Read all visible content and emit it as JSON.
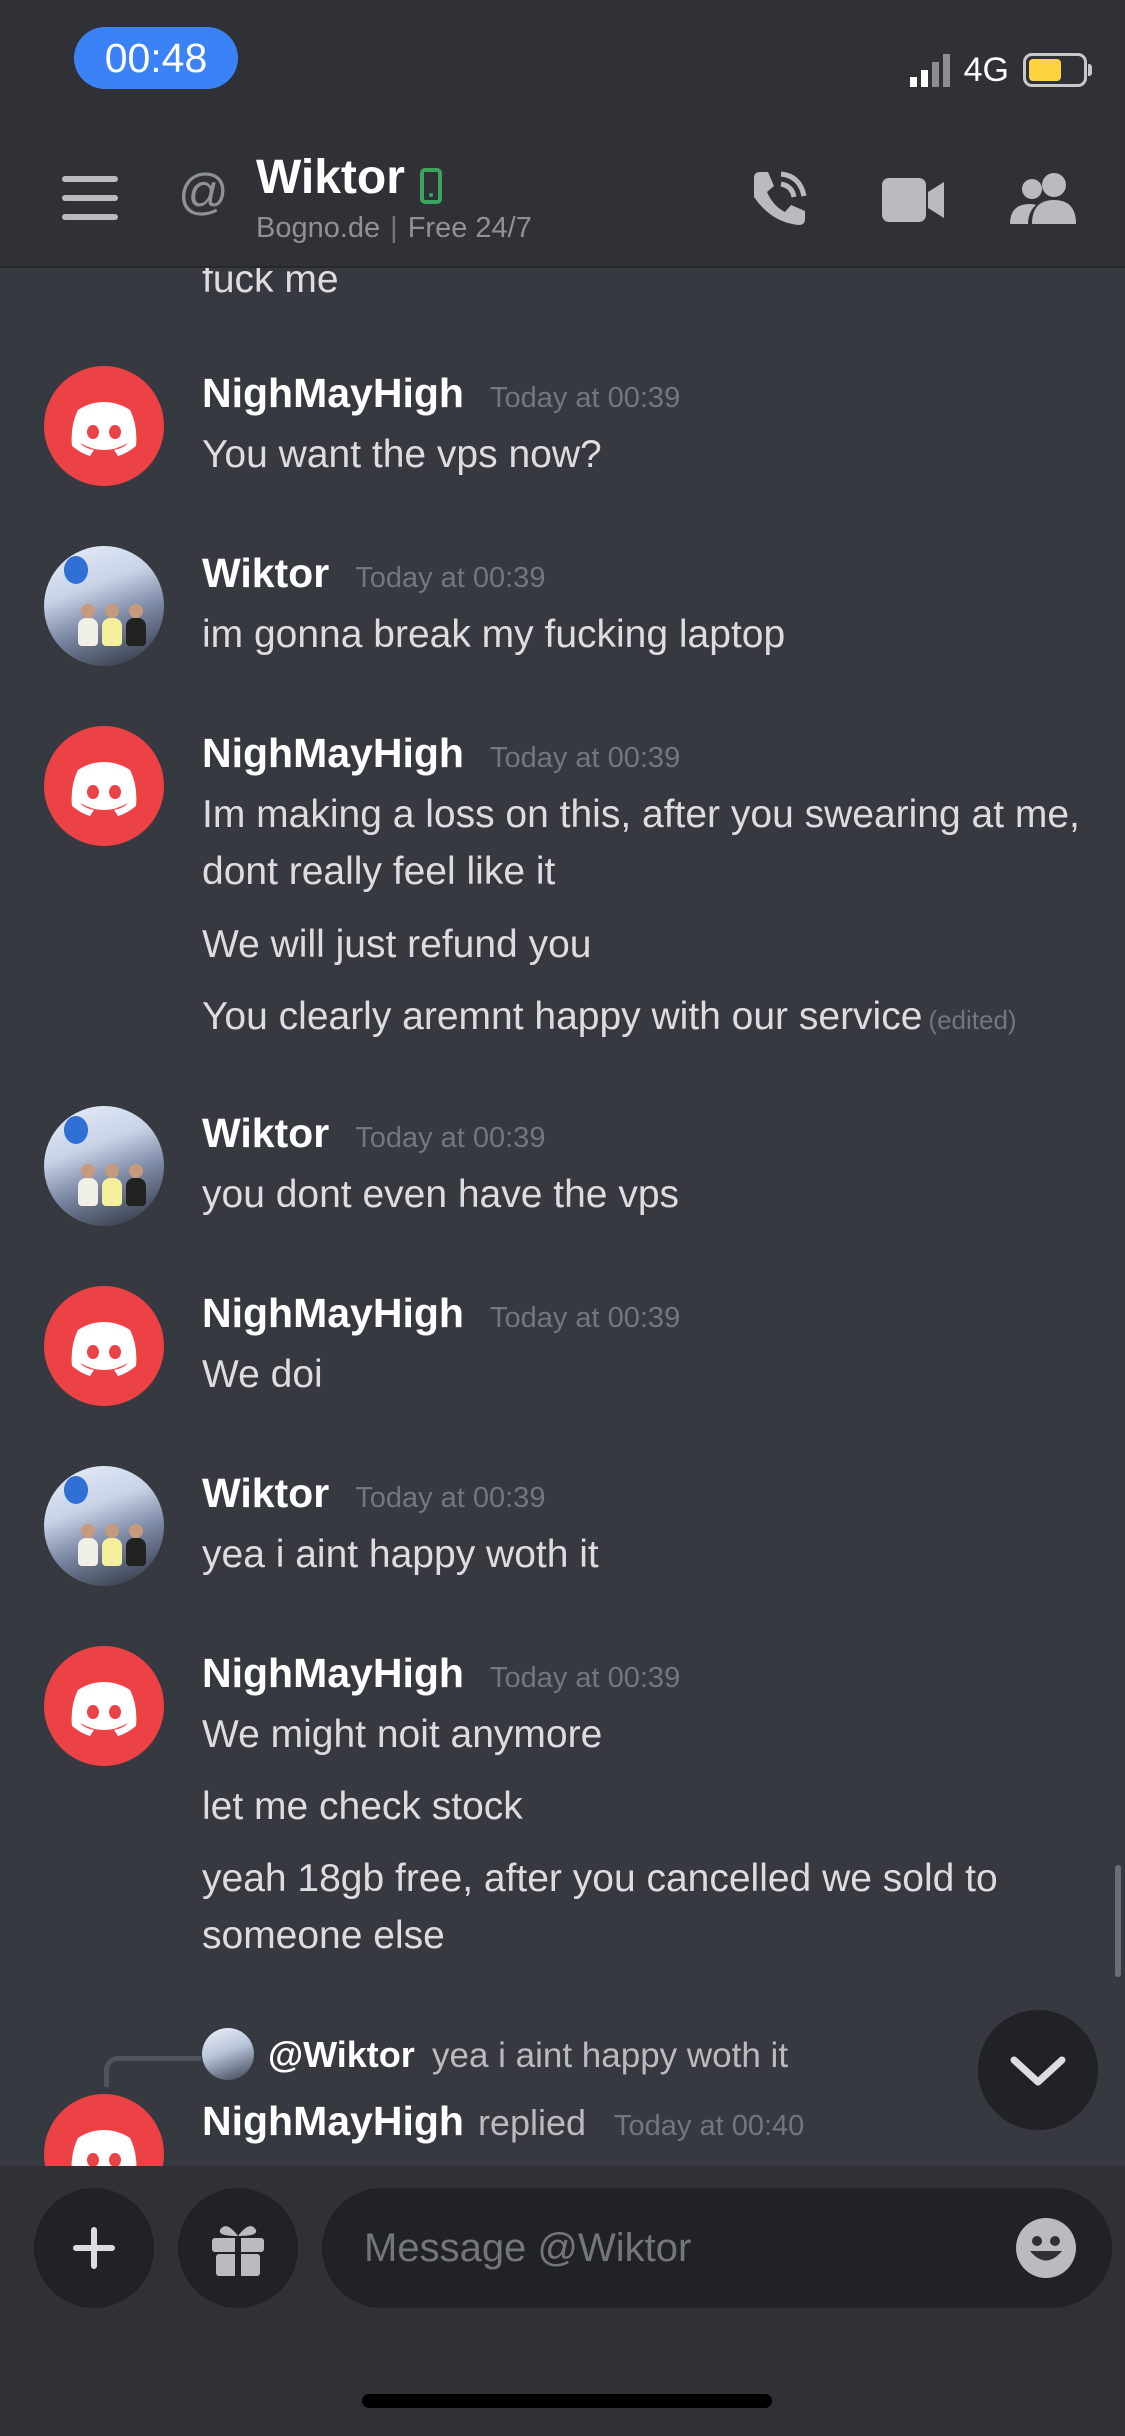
{
  "status_bar": {
    "time": "00:48",
    "network": "4G"
  },
  "header": {
    "at_symbol": "@",
    "name": "Wiktor",
    "subtitle_left": "Bogno.de",
    "subtitle_separator": "|",
    "subtitle_right": "Free 24/7"
  },
  "messages": {
    "cut_text": "fuck me",
    "groups": [
      {
        "author": "NighMayHigh",
        "time": "Today at 00:39",
        "avatar": "discord-logo",
        "lines": [
          "You want the vps now?"
        ]
      },
      {
        "author": "Wiktor",
        "time": "Today at 00:39",
        "avatar": "photo",
        "lines": [
          "im gonna break my fucking laptop"
        ]
      },
      {
        "author": "NighMayHigh",
        "time": "Today at 00:39",
        "avatar": "discord-logo",
        "lines": [
          "Im making a loss on this, after you swearing at me, dont really feel like it",
          "We will just refund you",
          "You clearly aremnt happy with our service"
        ],
        "edited_label": "(edited)"
      },
      {
        "author": "Wiktor",
        "time": "Today at 00:39",
        "avatar": "photo",
        "lines": [
          "you dont even have the vps"
        ]
      },
      {
        "author": "NighMayHigh",
        "time": "Today at 00:39",
        "avatar": "discord-logo",
        "lines": [
          "We doi"
        ]
      },
      {
        "author": "Wiktor",
        "time": "Today at 00:39",
        "avatar": "photo",
        "lines": [
          "yea i aint happy woth it"
        ]
      },
      {
        "author": "NighMayHigh",
        "time": "Today at 00:39",
        "avatar": "discord-logo",
        "lines": [
          "We might noit anymore",
          "let me check stock",
          "yeah 18gb free, after you cancelled we sold to someone else"
        ]
      }
    ],
    "reply": {
      "mention": "@Wiktor",
      "quoted": "yea i aint happy woth it",
      "author": "NighMayHigh",
      "replied_label": "replied",
      "time": "Today at 00:40"
    }
  },
  "composer": {
    "placeholder": "Message @Wiktor"
  },
  "icons": {
    "menu": "hamburger-icon",
    "call": "phone-call-icon",
    "video": "video-camera-icon",
    "members": "members-icon",
    "add": "plus-icon",
    "gift": "gift-icon",
    "emoji": "emoji-icon",
    "jump": "chevron-down-icon"
  },
  "colors": {
    "background": "#36393f",
    "header": "#2f3136",
    "discord_red": "#ed4245",
    "online_green": "#3ba55d",
    "clock_pill": "#3b82f6"
  }
}
